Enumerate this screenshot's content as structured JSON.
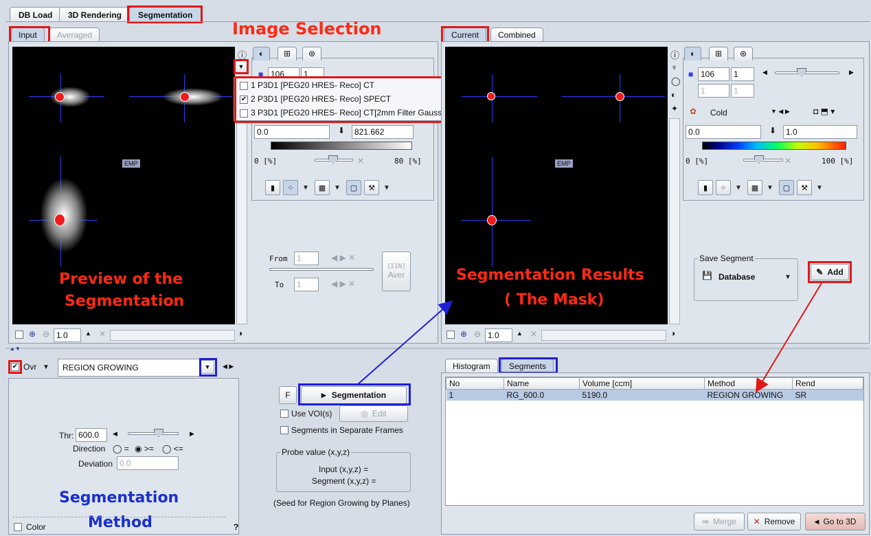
{
  "main_tabs": [
    "DB Load",
    "3D Rendering",
    "Segmentation"
  ],
  "left_view": {
    "tabs": [
      "Input",
      "Averaged"
    ],
    "emp_label": "EMP",
    "zoom": "1.0"
  },
  "right_view": {
    "tabs": [
      "Current",
      "Combined"
    ],
    "emp_label": "EMP",
    "zoom": "1.0"
  },
  "series_dropdown": {
    "items": [
      {
        "label": "1 P3D1 [PEG20 HRES- Reco] CT",
        "checked": false
      },
      {
        "label": "2 P3D1 [PEG20 HRES- Reco] SPECT",
        "checked": true
      },
      {
        "label": "3 P3D1 [PEG20 HRES- Reco] CT[2mm Filter Gauss]",
        "checked": false
      }
    ]
  },
  "left_controls": {
    "slice": "106",
    "frame": "1",
    "min": "0.0",
    "max": "821.662",
    "range_min": "0 [%]",
    "range_max": "80 [%]",
    "from_label": "From",
    "from_value": "1",
    "to_label": "To",
    "to_value": "1",
    "sum_label": "[ΣIN]",
    "aver_label": "Aver"
  },
  "right_controls": {
    "slice": "106",
    "frame": "1",
    "frame2a": "1",
    "frame2b": "1",
    "colormap": "Cold",
    "min": "0.0",
    "max": "1.0",
    "range_min": "0 [%]",
    "range_max": "100 [%]"
  },
  "save_segment": {
    "legend": "Save Segment",
    "target": "Database",
    "add_label": "Add"
  },
  "method": {
    "ovr_label": "Ovr",
    "selected": "REGION GROWING",
    "thr_label": "Thr:",
    "thr_value": "600.0",
    "direction_label": "Direction",
    "direction_options": [
      "=",
      ">=",
      "<="
    ],
    "deviation_label": "Deviation",
    "deviation_value": "0.0",
    "color_label": "Color",
    "help": "?"
  },
  "middle": {
    "f_label": "F",
    "segmentation_button": "Segmentation",
    "use_vois": "Use VOI(s)",
    "edit": "Edit",
    "separate_frames": "Segments in Separate Frames",
    "probe_legend": "Probe value (x,y,z)",
    "input_xyz": "Input (x,y,z) =",
    "segment_xyz": "Segment (x,y,z) =",
    "seed_note": "(Seed for Region Growing by Planes)"
  },
  "results": {
    "tabs": [
      "Histogram",
      "Segments"
    ],
    "columns": [
      "No",
      "Name",
      "Volume [ccm]",
      "Method",
      "Rend"
    ],
    "rows": [
      [
        "1",
        "RG_600.0",
        "5190.0",
        "REGION GROWING",
        "SR"
      ]
    ],
    "merge": "Merge",
    "remove": "Remove",
    "goto3d": "Go to 3D"
  },
  "annotations": {
    "image_selection": "Image Selection",
    "preview_line1": "Preview of the",
    "preview_line2": "Segmentation",
    "results_line1": "Segmentation Results",
    "results_line2": "( The Mask)",
    "method_line1": "Segmentation",
    "method_line2": "Method"
  },
  "colors": {
    "annotation_red": "#ff2a14",
    "annotation_blue": "#1a2fcf",
    "selection_row": "#b9cbe3"
  }
}
